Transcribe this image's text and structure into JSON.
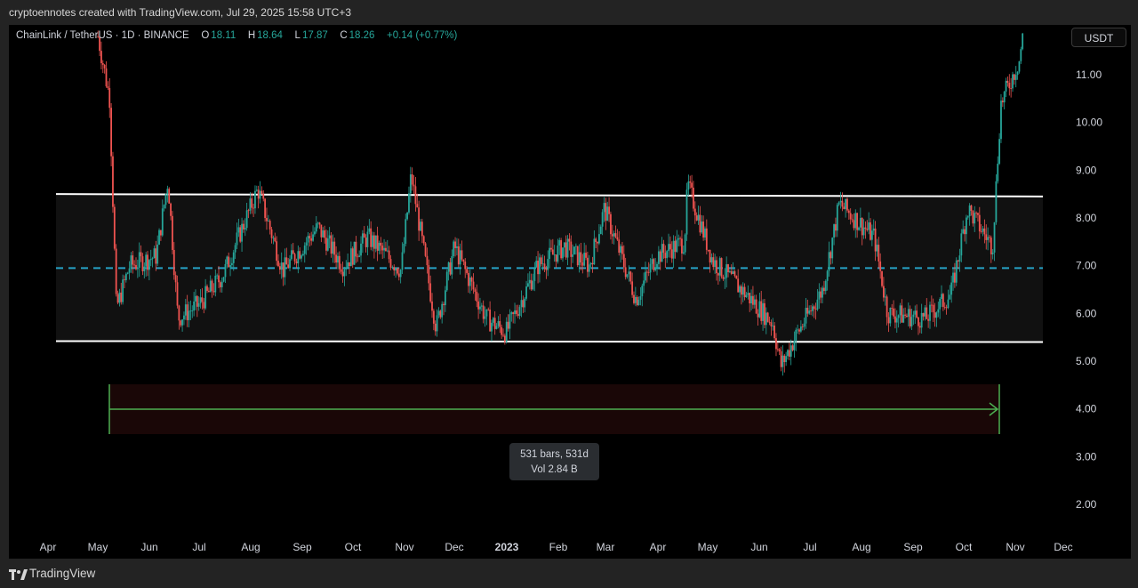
{
  "header": {
    "attribution": "cryptoennotes created with TradingView.com, Jul 29, 2025 15:58 UTC+3"
  },
  "legend": {
    "symbol": "ChainLink / TetherUS · 1D · BINANCE",
    "open_label": "O",
    "open": "18.11",
    "high_label": "H",
    "high": "18.64",
    "low_label": "L",
    "low": "17.87",
    "close_label": "C",
    "close": "18.26",
    "change": "+0.14 (+0.77%)"
  },
  "currency_button": "USDT",
  "measure_tooltip": {
    "bars": "531 bars, 531d",
    "volume": "Vol 2.84 B"
  },
  "footer": {
    "brand": "TradingView"
  },
  "colors": {
    "up": "#26a69a",
    "down": "#ef5350",
    "channel_line": "#ffffff",
    "midline": "#26a2c6",
    "measure_arrow": "#4caf50",
    "measure_fill": "#1a0707"
  },
  "chart_data": {
    "type": "candlestick",
    "symbol": "LINKUSDT",
    "timeframe": "1D",
    "y_axis": {
      "ylim": [
        1.2,
        12.0
      ],
      "ticks": [
        "11.00",
        "10.00",
        "9.00",
        "8.00",
        "7.00",
        "6.00",
        "5.00",
        "4.00",
        "3.00",
        "2.00"
      ],
      "tick_values": [
        11,
        10,
        9,
        8,
        7,
        6,
        5,
        4,
        3,
        2
      ]
    },
    "x_axis": {
      "ticks": [
        "Apr",
        "May",
        "Jun",
        "Jul",
        "Aug",
        "Sep",
        "Oct",
        "Nov",
        "Dec",
        "2023",
        "Feb",
        "Mar",
        "Apr",
        "May",
        "Jun",
        "Jul",
        "Aug",
        "Sep",
        "Oct",
        "Nov",
        "Dec"
      ],
      "bold_tick": "2023"
    },
    "price_path": [
      {
        "date": "2022-05-01",
        "price": 11.8
      },
      {
        "date": "2022-05-08",
        "price": 10.5
      },
      {
        "date": "2022-05-12",
        "price": 6.1
      },
      {
        "date": "2022-05-20",
        "price": 7.0
      },
      {
        "date": "2022-06-05",
        "price": 7.2
      },
      {
        "date": "2022-06-12",
        "price": 8.8
      },
      {
        "date": "2022-06-18",
        "price": 5.9
      },
      {
        "date": "2022-07-01",
        "price": 6.2
      },
      {
        "date": "2022-07-15",
        "price": 6.8
      },
      {
        "date": "2022-08-05",
        "price": 8.6
      },
      {
        "date": "2022-08-20",
        "price": 6.9
      },
      {
        "date": "2022-09-10",
        "price": 7.8
      },
      {
        "date": "2022-09-25",
        "price": 7.0
      },
      {
        "date": "2022-10-10",
        "price": 7.6
      },
      {
        "date": "2022-10-30",
        "price": 6.9
      },
      {
        "date": "2022-11-05",
        "price": 8.9
      },
      {
        "date": "2022-11-20",
        "price": 5.7
      },
      {
        "date": "2022-12-01",
        "price": 7.4
      },
      {
        "date": "2022-12-20",
        "price": 5.9
      },
      {
        "date": "2023-01-01",
        "price": 5.6
      },
      {
        "date": "2023-01-20",
        "price": 7.0
      },
      {
        "date": "2023-02-05",
        "price": 7.4
      },
      {
        "date": "2023-02-20",
        "price": 7.0
      },
      {
        "date": "2023-03-01",
        "price": 8.2
      },
      {
        "date": "2023-03-20",
        "price": 6.3
      },
      {
        "date": "2023-04-01",
        "price": 7.2
      },
      {
        "date": "2023-04-18",
        "price": 7.5
      },
      {
        "date": "2023-04-20",
        "price": 8.7
      },
      {
        "date": "2023-05-05",
        "price": 7.1
      },
      {
        "date": "2023-05-25",
        "price": 6.4
      },
      {
        "date": "2023-06-10",
        "price": 5.8
      },
      {
        "date": "2023-06-15",
        "price": 4.9
      },
      {
        "date": "2023-06-25",
        "price": 5.6
      },
      {
        "date": "2023-07-10",
        "price": 6.5
      },
      {
        "date": "2023-07-20",
        "price": 8.3
      },
      {
        "date": "2023-08-10",
        "price": 7.6
      },
      {
        "date": "2023-08-18",
        "price": 6.0
      },
      {
        "date": "2023-09-10",
        "price": 5.9
      },
      {
        "date": "2023-09-25",
        "price": 6.4
      },
      {
        "date": "2023-10-05",
        "price": 8.2
      },
      {
        "date": "2023-10-20",
        "price": 7.4
      },
      {
        "date": "2023-10-25",
        "price": 10.4
      },
      {
        "date": "2023-11-05",
        "price": 11.3
      },
      {
        "date": "2023-11-08",
        "price": 12.0
      }
    ],
    "channel": {
      "upper": {
        "start": 8.5,
        "end": 8.45
      },
      "lower": {
        "start": 5.42,
        "end": 5.4
      },
      "midline": 6.95
    },
    "measurement": {
      "bars": 531,
      "days": 531,
      "volume": "2.84 B"
    }
  }
}
